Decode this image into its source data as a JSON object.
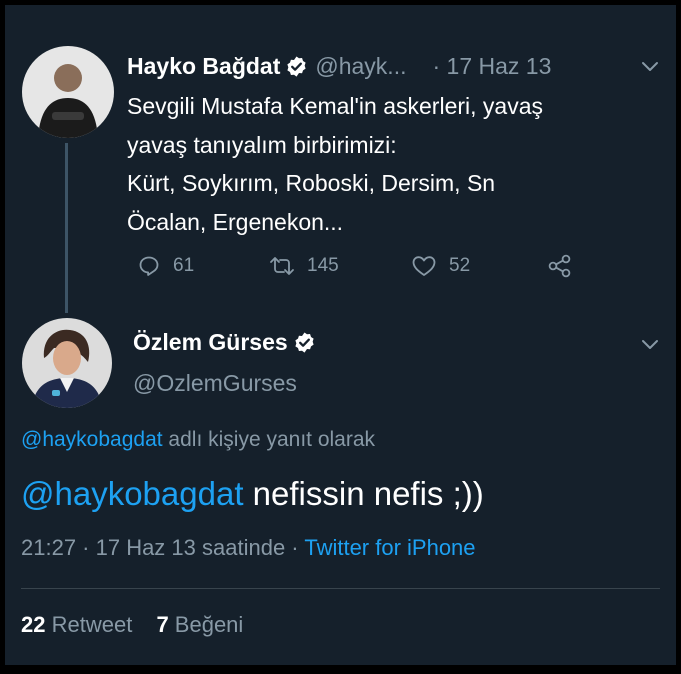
{
  "parent_tweet": {
    "author_name": "Hayko Bağdat",
    "handle": "@hayk...",
    "date": "· 17 Haz 13",
    "text_lines": [
      "Sevgili Mustafa Kemal'in askerleri, yavaş",
      "yavaş tanıyalım birbirimizi:",
      "Kürt, Soykırım, Roboski, Dersim, Sn",
      "Öcalan, Ergenekon..."
    ],
    "reply_count": "61",
    "retweet_count": "145",
    "like_count": "52"
  },
  "main_tweet": {
    "author_name": "Özlem Gürses",
    "handle": "@OzlemGurses",
    "replying_to_handle": "@haykobagdat",
    "replying_to_suffix": " adlı kişiye yanıt olarak",
    "text_mention": "@haykobagdat",
    "text_body": " nefissin nefis ;))",
    "time_date": "21:27 · 17 Haz 13 saatinde · ",
    "source": "Twitter for iPhone",
    "retweets_value": "22",
    "retweets_label": " Retweet",
    "likes_value": "7",
    "likes_label": " Beğeni"
  },
  "colors": {
    "background": "#15202b",
    "text": "#ffffff",
    "muted": "#8899a6",
    "link": "#1da1f2",
    "divider": "#38444d"
  },
  "icons": [
    "verified-badge-icon",
    "chevron-down-icon",
    "reply-icon",
    "retweet-icon",
    "like-heart-icon",
    "share-icon"
  ]
}
